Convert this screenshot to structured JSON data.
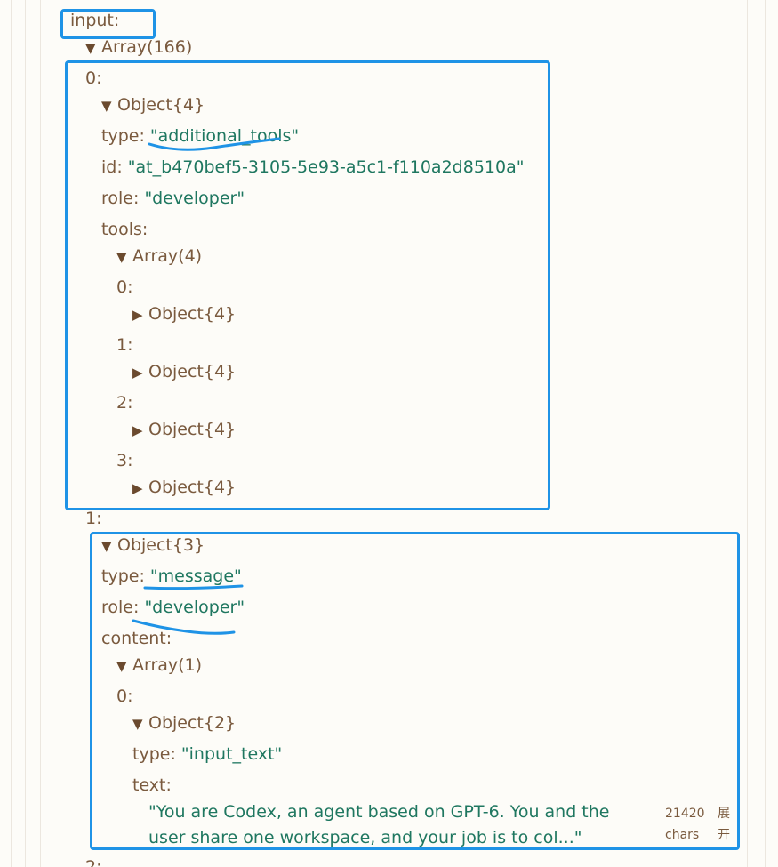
{
  "tree": {
    "input_key": "input:",
    "input_type": "Array(166)",
    "item0": {
      "index": "0:",
      "type": "Object{4}",
      "type_key": "type:",
      "type_val": "\"additional_tools\"",
      "id_key": "id:",
      "id_val": "\"at_b470bef5-3105-5e93-a5c1-f110a2d8510a\"",
      "role_key": "role:",
      "role_val": "\"developer\"",
      "tools_key": "tools:",
      "tools_type": "Array(4)",
      "tools": [
        {
          "index": "0:",
          "type": "Object{4}"
        },
        {
          "index": "1:",
          "type": "Object{4}"
        },
        {
          "index": "2:",
          "type": "Object{4}"
        },
        {
          "index": "3:",
          "type": "Object{4}"
        }
      ]
    },
    "item1": {
      "index": "1:",
      "type": "Object{3}",
      "type_key": "type:",
      "type_val": "\"message\"",
      "role_key": "role:",
      "role_val": "\"developer\"",
      "content_key": "content:",
      "content_type": "Array(1)",
      "c0_index": "0:",
      "c0_type": "Object{2}",
      "c0_type_key": "type:",
      "c0_type_val": "\"input_text\"",
      "c0_text_key": "text:",
      "c0_text_val": "\"You are Codex, an agent based on GPT-6. You and the user share one workspace, and your job is to col...\"",
      "char_count": "21420",
      "char_unit": "chars",
      "expand_top": "展",
      "expand_bottom": "开"
    },
    "item2_index": "2:"
  },
  "icons": {
    "expanded": "▼",
    "collapsed": "▶"
  },
  "colors": {
    "highlight": "#1f93e6",
    "key": "#7a5a3e",
    "string": "#1f7760"
  }
}
